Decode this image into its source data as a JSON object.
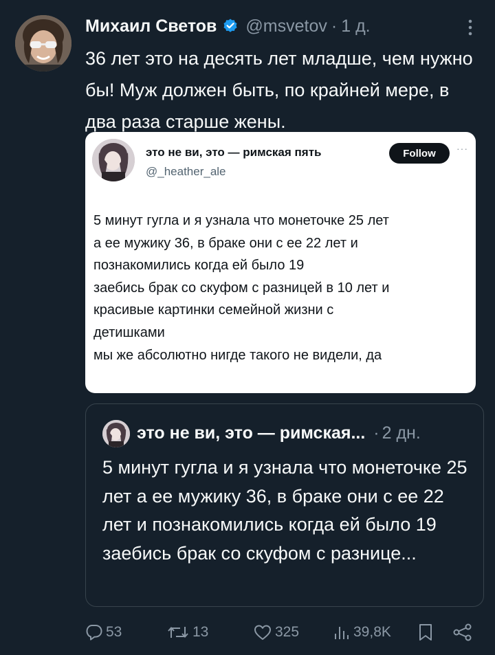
{
  "tweet": {
    "author_name": "Михаил Светов",
    "handle": "@msvetov",
    "separator": "·",
    "time": "1 д.",
    "text": "36 лет это на десять лет младше, чем нужно бы! Муж должен быть, по крайней мере, в два раза старше жены."
  },
  "screenshot": {
    "name": "это не ви, это — римская пять",
    "handle": "@_heather_ale",
    "follow_label": "Follow",
    "more_label": "···",
    "lines": [
      "5 минут гугла и я узнала что монеточке 25 лет",
      "а ее мужику 36, в браке они с ее 22 лет и",
      "познакомились когда ей было 19",
      "заебись брак со скуфом с разницей в 10 лет и",
      "красивые картинки семейной жизни с",
      "детишками",
      "мы же абсолютно нигде такого не видели, да"
    ]
  },
  "quote": {
    "name": "это не ви, это — римская...",
    "separator": "·",
    "time": "2 дн.",
    "text": "5 минут гугла и я узнала что монеточке 25 лет а ее мужику 36, в браке они с ее 22 лет и познакомились когда ей было 19 заебись брак со скуфом с разнице..."
  },
  "actions": {
    "replies": "53",
    "reposts": "13",
    "likes": "325",
    "views": "39,8K"
  },
  "colors": {
    "background": "#15202b",
    "text_primary": "#f7f9f9",
    "text_secondary": "#8b98a5",
    "verified_badge": "#1d9bf0",
    "border": "#38444d"
  },
  "icons": {
    "verified": "verified-badge-icon",
    "more": "more-vertical-icon",
    "reply": "reply-icon",
    "repost": "repost-icon",
    "like": "heart-icon",
    "views": "views-chart-icon",
    "bookmark": "bookmark-icon",
    "share": "share-icon"
  }
}
